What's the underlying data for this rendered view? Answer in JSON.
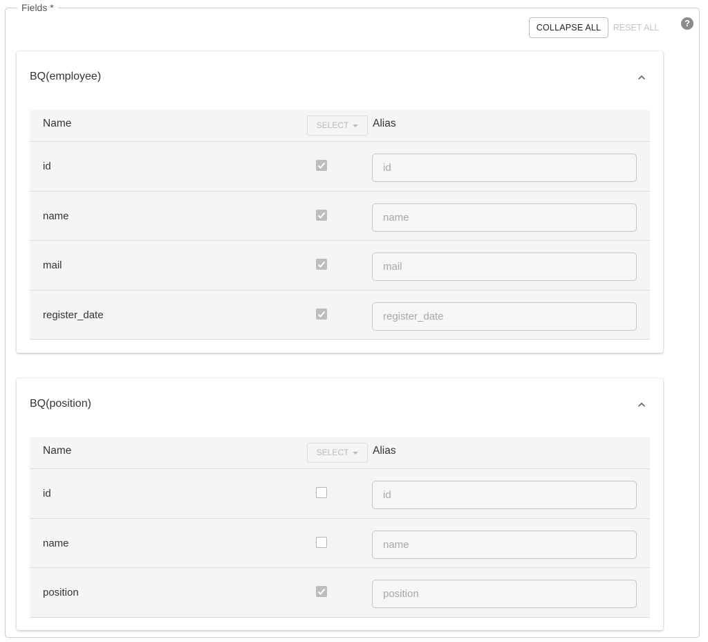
{
  "fieldset": {
    "legend": "Fields *"
  },
  "toolbar": {
    "collapse_all_label": "COLLAPSE ALL",
    "reset_all_label": "RESET ALL",
    "help_icon": "?"
  },
  "sections": [
    {
      "title": "BQ(employee)",
      "columns": {
        "name": "Name",
        "select": "SELECT",
        "alias": "Alias"
      },
      "rows": [
        {
          "name": "id",
          "checked": true,
          "alias_placeholder": "id"
        },
        {
          "name": "name",
          "checked": true,
          "alias_placeholder": "name"
        },
        {
          "name": "mail",
          "checked": true,
          "alias_placeholder": "mail"
        },
        {
          "name": "register_date",
          "checked": true,
          "alias_placeholder": "register_date"
        }
      ]
    },
    {
      "title": "BQ(position)",
      "columns": {
        "name": "Name",
        "select": "SELECT",
        "alias": "Alias"
      },
      "rows": [
        {
          "name": "id",
          "checked": false,
          "alias_placeholder": "id"
        },
        {
          "name": "name",
          "checked": false,
          "alias_placeholder": "name"
        },
        {
          "name": "position",
          "checked": true,
          "alias_placeholder": "position"
        }
      ]
    }
  ],
  "colors": {
    "checkbox_checked": "#bdbdbd",
    "row_background": "#f5f5f5",
    "reset_disabled": "#c4c4c4"
  }
}
